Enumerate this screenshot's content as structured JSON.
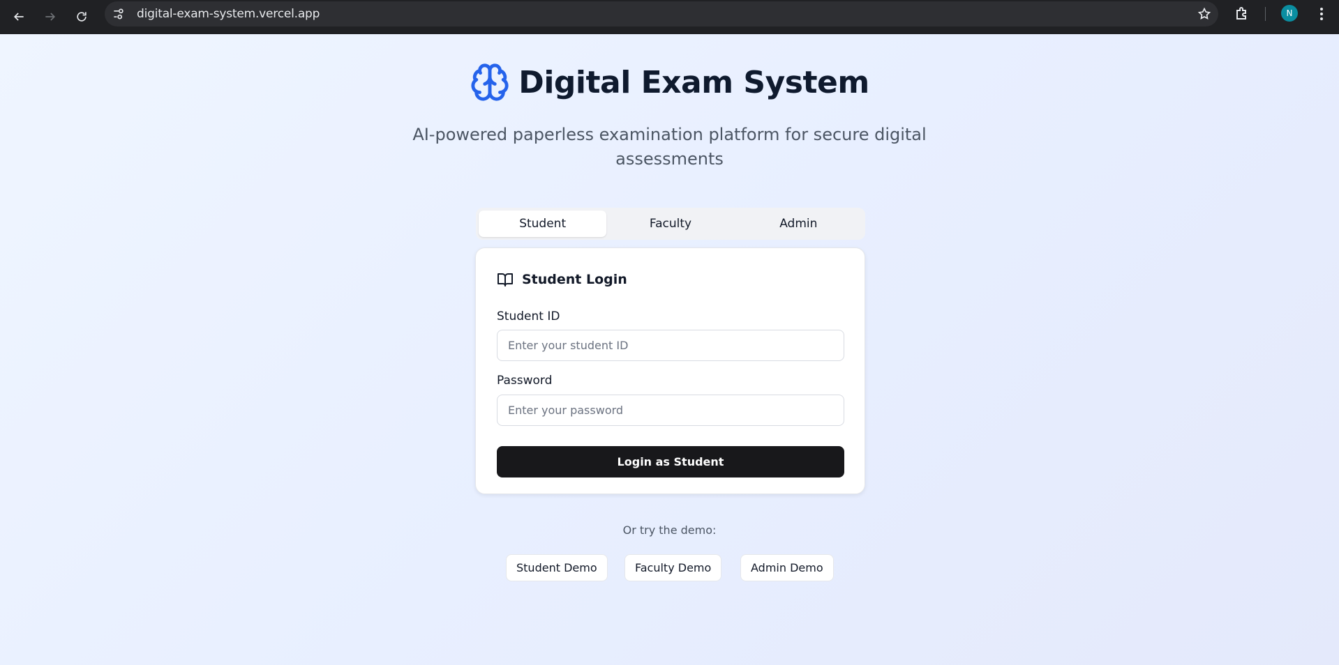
{
  "browser": {
    "url": "digital-exam-system.vercel.app",
    "profile_initial": "N"
  },
  "hero": {
    "title": "Digital Exam System",
    "subtitle": "AI-powered paperless examination platform for secure digital assessments"
  },
  "tabs": [
    {
      "label": "Student",
      "active": true
    },
    {
      "label": "Faculty",
      "active": false
    },
    {
      "label": "Admin",
      "active": false
    }
  ],
  "login_card": {
    "title": "Student Login",
    "id_label": "Student ID",
    "id_placeholder": "Enter your student ID",
    "password_label": "Password",
    "password_placeholder": "Enter your password",
    "submit_label": "Login as Student"
  },
  "demo": {
    "prompt": "Or try the demo:",
    "buttons": [
      "Student Demo",
      "Faculty Demo",
      "Admin Demo"
    ]
  },
  "colors": {
    "accent": "#2563eb",
    "primary_button": "#18181b",
    "avatar": "#0b8ea1"
  }
}
